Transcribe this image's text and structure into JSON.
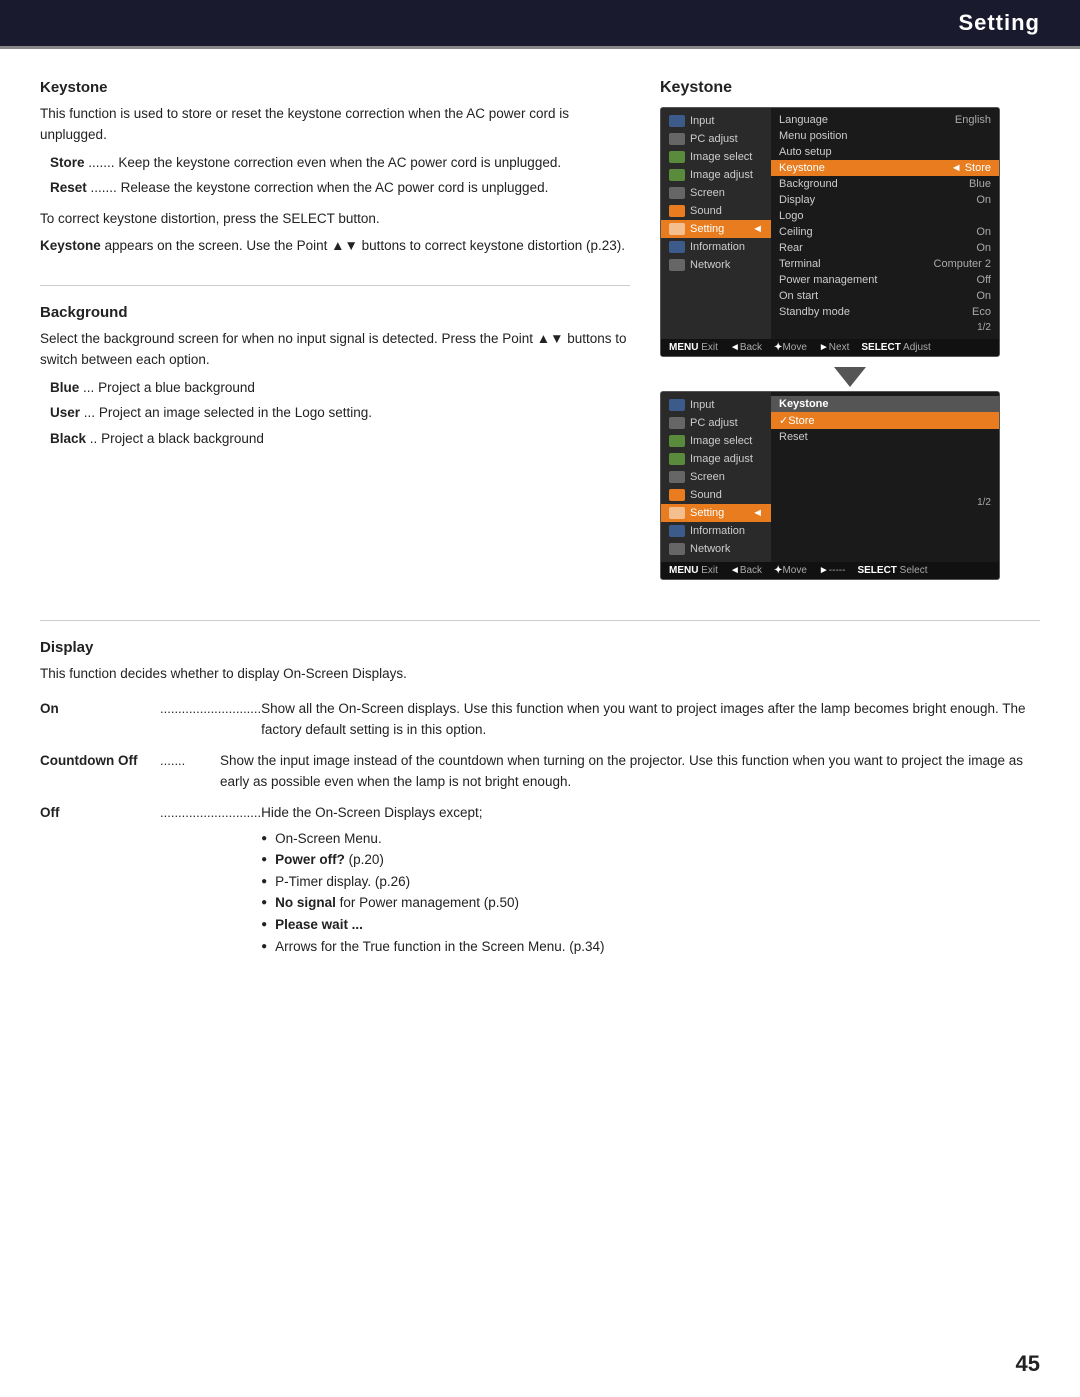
{
  "header": {
    "title": "Setting"
  },
  "page_number": "45",
  "keystone_section": {
    "heading": "Keystone",
    "intro": "This function is used to store or reset the keystone correction when the AC power cord is unplugged.",
    "store_label": "Store",
    "store_dots": ".......",
    "store_text": "Keep the keystone correction even when the AC power cord is unplugged.",
    "reset_label": "Reset",
    "reset_dots": ".......",
    "reset_text": "Release the keystone correction when the AC power cord is unplugged.",
    "para1": "To correct keystone distortion, press the SELECT button.",
    "para2": "Keystone appears on the screen. Use the Point ▲▼ buttons to correct keystone distortion (p.23)."
  },
  "background_section": {
    "heading": "Background",
    "intro": "Select the background screen for when no input signal is detected. Press the Point ▲▼ buttons to switch between each option.",
    "blue_label": "Blue",
    "blue_dots": "...",
    "blue_text": "Project a blue background",
    "user_label": "User",
    "user_dots": "...",
    "user_text": "Project an image selected in the Logo setting.",
    "black_label": "Black",
    "black_dots": "..",
    "black_text": "Project a black background"
  },
  "display_section": {
    "heading": "Display",
    "intro": "This function decides whether to display On-Screen Displays.",
    "on_label": "On",
    "on_dots": "............................",
    "on_text": "Show all the On-Screen displays. Use this function when you want to project images after the lamp becomes bright enough. The factory default setting is in this option.",
    "countdown_label": "Countdown Off",
    "countdown_dots": ".......",
    "countdown_text": "Show the input image instead of the countdown when turning on the projector. Use this function when you want to project the image as early as possible even when the lamp is not bright enough.",
    "off_label": "Off",
    "off_dots": "............................",
    "off_text": "Hide the On-Screen Displays except;",
    "off_bullets": [
      "On-Screen Menu.",
      "Power off? (p.20)",
      "P-Timer display. (p.26)",
      "No signal for Power management (p.50)",
      "Please wait ...",
      "Arrows for the True function in the Screen Menu. (p.34)"
    ]
  },
  "menu1": {
    "left_items": [
      {
        "label": "Input",
        "icon": "blue"
      },
      {
        "label": "PC adjust",
        "icon": "gray"
      },
      {
        "label": "Image select",
        "icon": "green"
      },
      {
        "label": "Image adjust",
        "icon": "green"
      },
      {
        "label": "Screen",
        "icon": "gray"
      },
      {
        "label": "Sound",
        "icon": "orange"
      },
      {
        "label": "Setting",
        "icon": "orange",
        "active": true
      },
      {
        "label": "Information",
        "icon": "blue"
      },
      {
        "label": "Network",
        "icon": "gray"
      }
    ],
    "right_items": [
      {
        "label": "Language",
        "value": "English"
      },
      {
        "label": "Menu position",
        "value": ""
      },
      {
        "label": "Auto setup",
        "value": ""
      },
      {
        "label": "Keystone",
        "value": "◄ Store",
        "active": true
      },
      {
        "label": "Background",
        "value": "Blue"
      },
      {
        "label": "Display",
        "value": "On"
      },
      {
        "label": "Logo",
        "value": ""
      },
      {
        "label": "Ceiling",
        "value": "On"
      },
      {
        "label": "Rear",
        "value": "On"
      },
      {
        "label": "Terminal",
        "value": "Computer 2"
      },
      {
        "label": "Power management",
        "value": "Off"
      },
      {
        "label": "On start",
        "value": "On"
      },
      {
        "label": "Standby mode",
        "value": "Eco"
      }
    ],
    "page_indicator": "1/2",
    "footer": [
      {
        "key": "MENU",
        "label": "Exit"
      },
      {
        "key": "◄Back",
        "label": ""
      },
      {
        "key": "✦Move",
        "label": ""
      },
      {
        "key": "►Next",
        "label": ""
      },
      {
        "key": "SELECT",
        "label": "Adjust"
      }
    ]
  },
  "menu2": {
    "left_items": [
      {
        "label": "Input",
        "icon": "blue"
      },
      {
        "label": "PC adjust",
        "icon": "gray"
      },
      {
        "label": "Image select",
        "icon": "green"
      },
      {
        "label": "Image adjust",
        "icon": "green"
      },
      {
        "label": "Screen",
        "icon": "gray"
      },
      {
        "label": "Sound",
        "icon": "orange"
      },
      {
        "label": "Setting",
        "icon": "orange",
        "active": true
      },
      {
        "label": "Information",
        "icon": "blue"
      },
      {
        "label": "Network",
        "icon": "gray"
      }
    ],
    "right_header": "Keystone",
    "right_items": [
      {
        "label": "✓Store",
        "value": "",
        "active": true
      },
      {
        "label": "Reset",
        "value": ""
      }
    ],
    "page_indicator": "1/2",
    "footer": [
      {
        "key": "MENU",
        "label": "Exit"
      },
      {
        "key": "◄Back",
        "label": ""
      },
      {
        "key": "✦Move",
        "label": ""
      },
      {
        "key": "►-----",
        "label": ""
      },
      {
        "key": "SELECT",
        "label": "Select"
      }
    ]
  }
}
